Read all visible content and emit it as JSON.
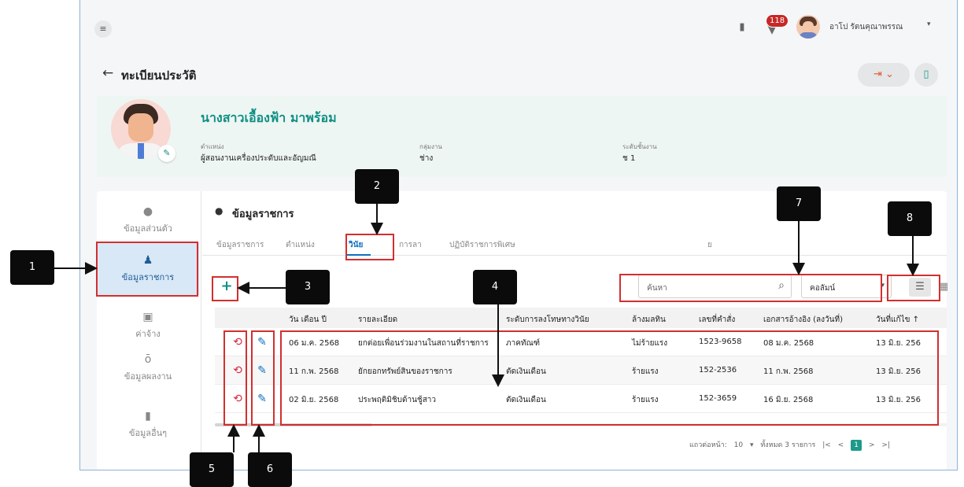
{
  "topbar": {
    "menu_icon": "menu-collapse-icon",
    "notifications_count": "118",
    "user_name": "อาโป รัตนคุณาพรรณ",
    "user_caret": "▾"
  },
  "header": {
    "back": "←",
    "title": "ทะเบียนประวัติ",
    "export_icon": "⇥ ⌄",
    "doc_icon": "▯"
  },
  "profile": {
    "name": "นางสาวเอื้องฟ้า มาพร้อม",
    "position_label": "ตำแหน่ง",
    "position_value": "ผู้สอนงานเครื่องประดับและอัญมณี",
    "group_label": "กลุ่มงาน",
    "group_value": "ช่าง",
    "level_label": "ระดับชั้นงาน",
    "level_value": "ช 1"
  },
  "sidenav": {
    "items": [
      {
        "label": "ข้อมูลส่วนตัว",
        "icon": "person-icon"
      },
      {
        "label": "ข้อมูลราชการ",
        "icon": "team-icon"
      },
      {
        "label": "ค่าจ้าง",
        "icon": "money-icon"
      },
      {
        "label": "ข้อมูลผลงาน",
        "icon": "medal-icon"
      },
      {
        "label": "ข้อมูลอื่นๆ",
        "icon": "bookmark-icon"
      }
    ]
  },
  "section": {
    "title": "ข้อมูลราชการ"
  },
  "tabs": [
    "ข้อมูลราชการ",
    "ตำแหน่ง",
    "วินัย",
    "การลา",
    "ปฏิบัติราชการพิเศษ",
    "ย"
  ],
  "toolbar": {
    "add": "+",
    "search_placeholder": "ค้นหา",
    "column_select": "คอลัมน์",
    "select_caret": "▾"
  },
  "table": {
    "headers": [
      "วัน เดือน ปี",
      "รายละเอียด",
      "ระดับการลงโทษทางวินัย",
      "ล้างมลทิน",
      "เลขที่คำสั่ง",
      "เอกสารอ้างอิง (ลงวันที่)",
      "วันที่แก้ไข ↑"
    ],
    "rows": [
      [
        "06 ม.ค. 2568",
        "ยกต่อยเพื่อนร่วมงานในสถานที่ราชการ",
        "ภาคทัณฑ์",
        "ไม่ร้ายแรง",
        "1523-9658",
        "08 ม.ค. 2568",
        "13 มิ.ย. 256"
      ],
      [
        "11 ก.พ. 2568",
        "ยักยอกทรัพย์สินของราชการ",
        "ตัดเงินเดือน",
        "ร้ายแรง",
        "152-2536",
        "11 ก.พ. 2568",
        "13 มิ.ย. 256"
      ],
      [
        "02 มิ.ย. 2568",
        "ประพฤติมิชิบด้านชู้สาว",
        "ตัดเงินเดือน",
        "ร้ายแรง",
        "152-3659",
        "16 มิ.ย. 2568",
        "13 มิ.ย. 256"
      ]
    ]
  },
  "pager": {
    "rows_per_page_label": "แถวต่อหน้า:",
    "rows_per_page": "10",
    "caret": "▾",
    "total": "ทั้งหมด 3 รายการ",
    "first": "|<",
    "prev": "<",
    "page": "1",
    "next": ">",
    "last": ">|"
  },
  "annotations": [
    "1",
    "2",
    "3",
    "4",
    "5",
    "6",
    "7",
    "8"
  ],
  "colors": {
    "accent": "#0f8f83",
    "active_tab": "#0f6fbf",
    "highlight": "#d32f2f",
    "callout": "#0b0b0b",
    "history_icon": "#d7263d"
  }
}
